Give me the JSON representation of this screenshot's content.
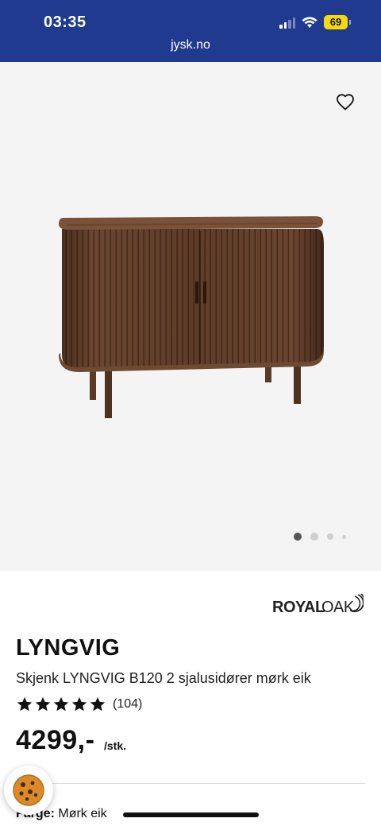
{
  "status_bar": {
    "time": "03:35",
    "battery": "69",
    "url": "jysk.no"
  },
  "gallery": {
    "favorite_icon": "heart-outline-icon",
    "image_alt": "Skjenk LYNGVIG",
    "dots_total": 4,
    "active_dot": 1
  },
  "product": {
    "brand": "ROYALOAK",
    "name": "LYNGVIG",
    "description": "Skjenk LYNGVIG B120 2 sjalusidører mørk eik",
    "rating_stars": 5,
    "rating_count": "(104)",
    "price": "4299,-",
    "unit": "/stk.",
    "color_label": "Farge:",
    "color_value": "Mørk eik"
  },
  "colors": {
    "brand_blue": "#1f3a8f",
    "battery_yellow": "#f5d90a",
    "wood": "#5a3b26"
  },
  "icons": {
    "cookie": "cookie-icon",
    "star": "star-icon"
  }
}
